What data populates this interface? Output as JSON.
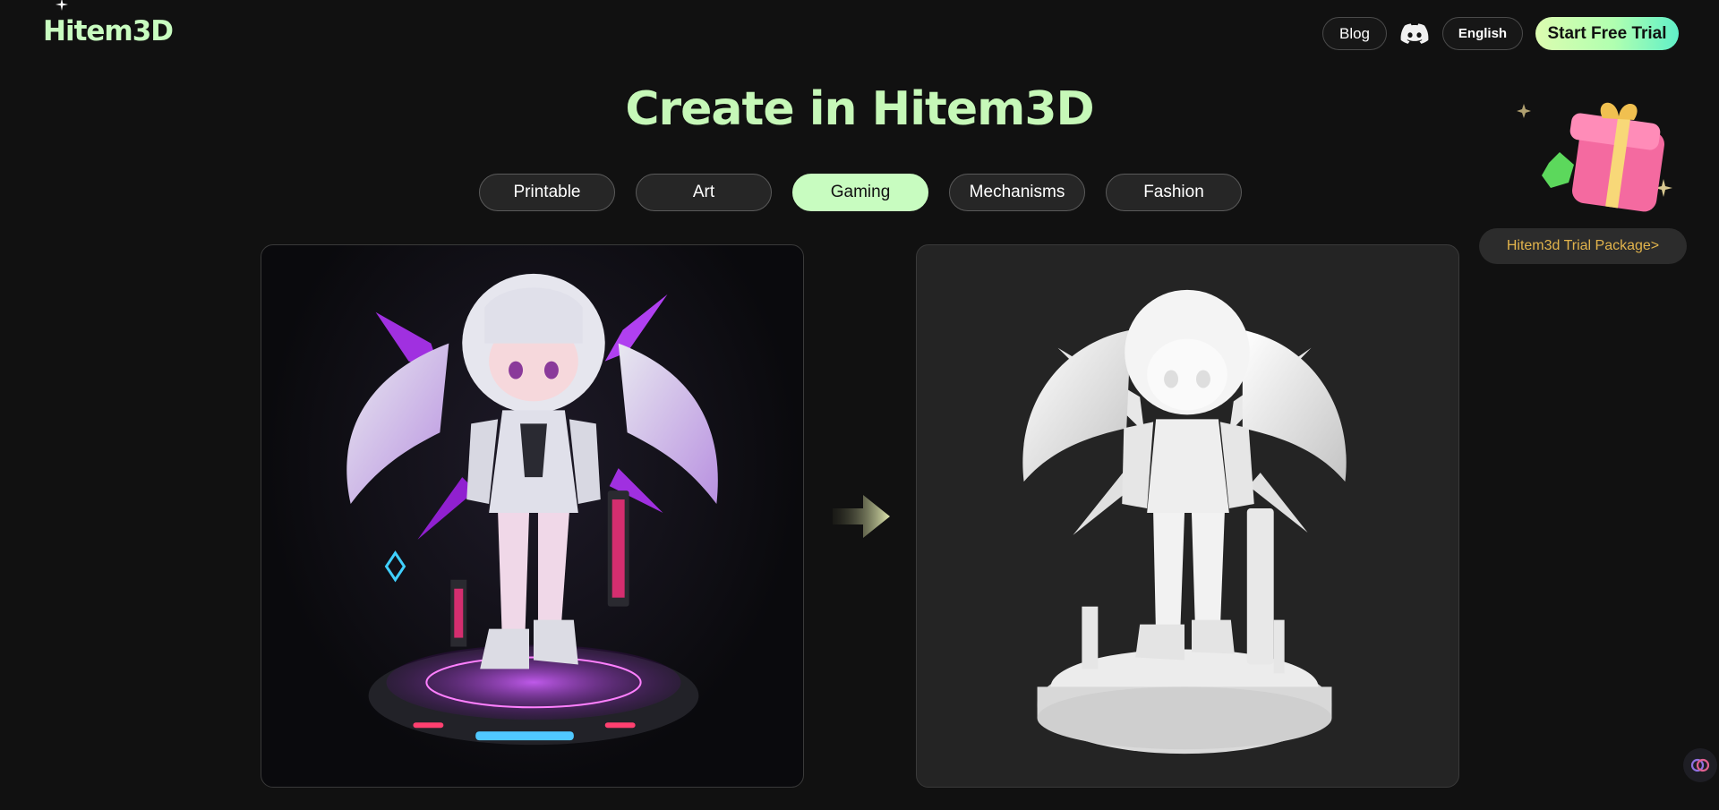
{
  "header": {
    "logo_text": "Hitem3D",
    "nav": {
      "blog_label": "Blog",
      "discord_icon": "discord-icon",
      "language_label": "English",
      "cta_label": "Start Free Trial"
    }
  },
  "main": {
    "title": "Create in Hitem3D",
    "tabs": [
      {
        "label": "Printable",
        "active": false
      },
      {
        "label": "Art",
        "active": false
      },
      {
        "label": "Gaming",
        "active": true
      },
      {
        "label": "Mechanisms",
        "active": false
      },
      {
        "label": "Fashion",
        "active": false
      }
    ],
    "arrow_icon": "arrow-right-icon"
  },
  "promo": {
    "gift_icon": "gift-box-icon",
    "label": "Hitem3d Trial Package>"
  },
  "colors": {
    "background": "#111111",
    "accent": "#c8fcc0",
    "promo_text": "#e2b44c"
  }
}
